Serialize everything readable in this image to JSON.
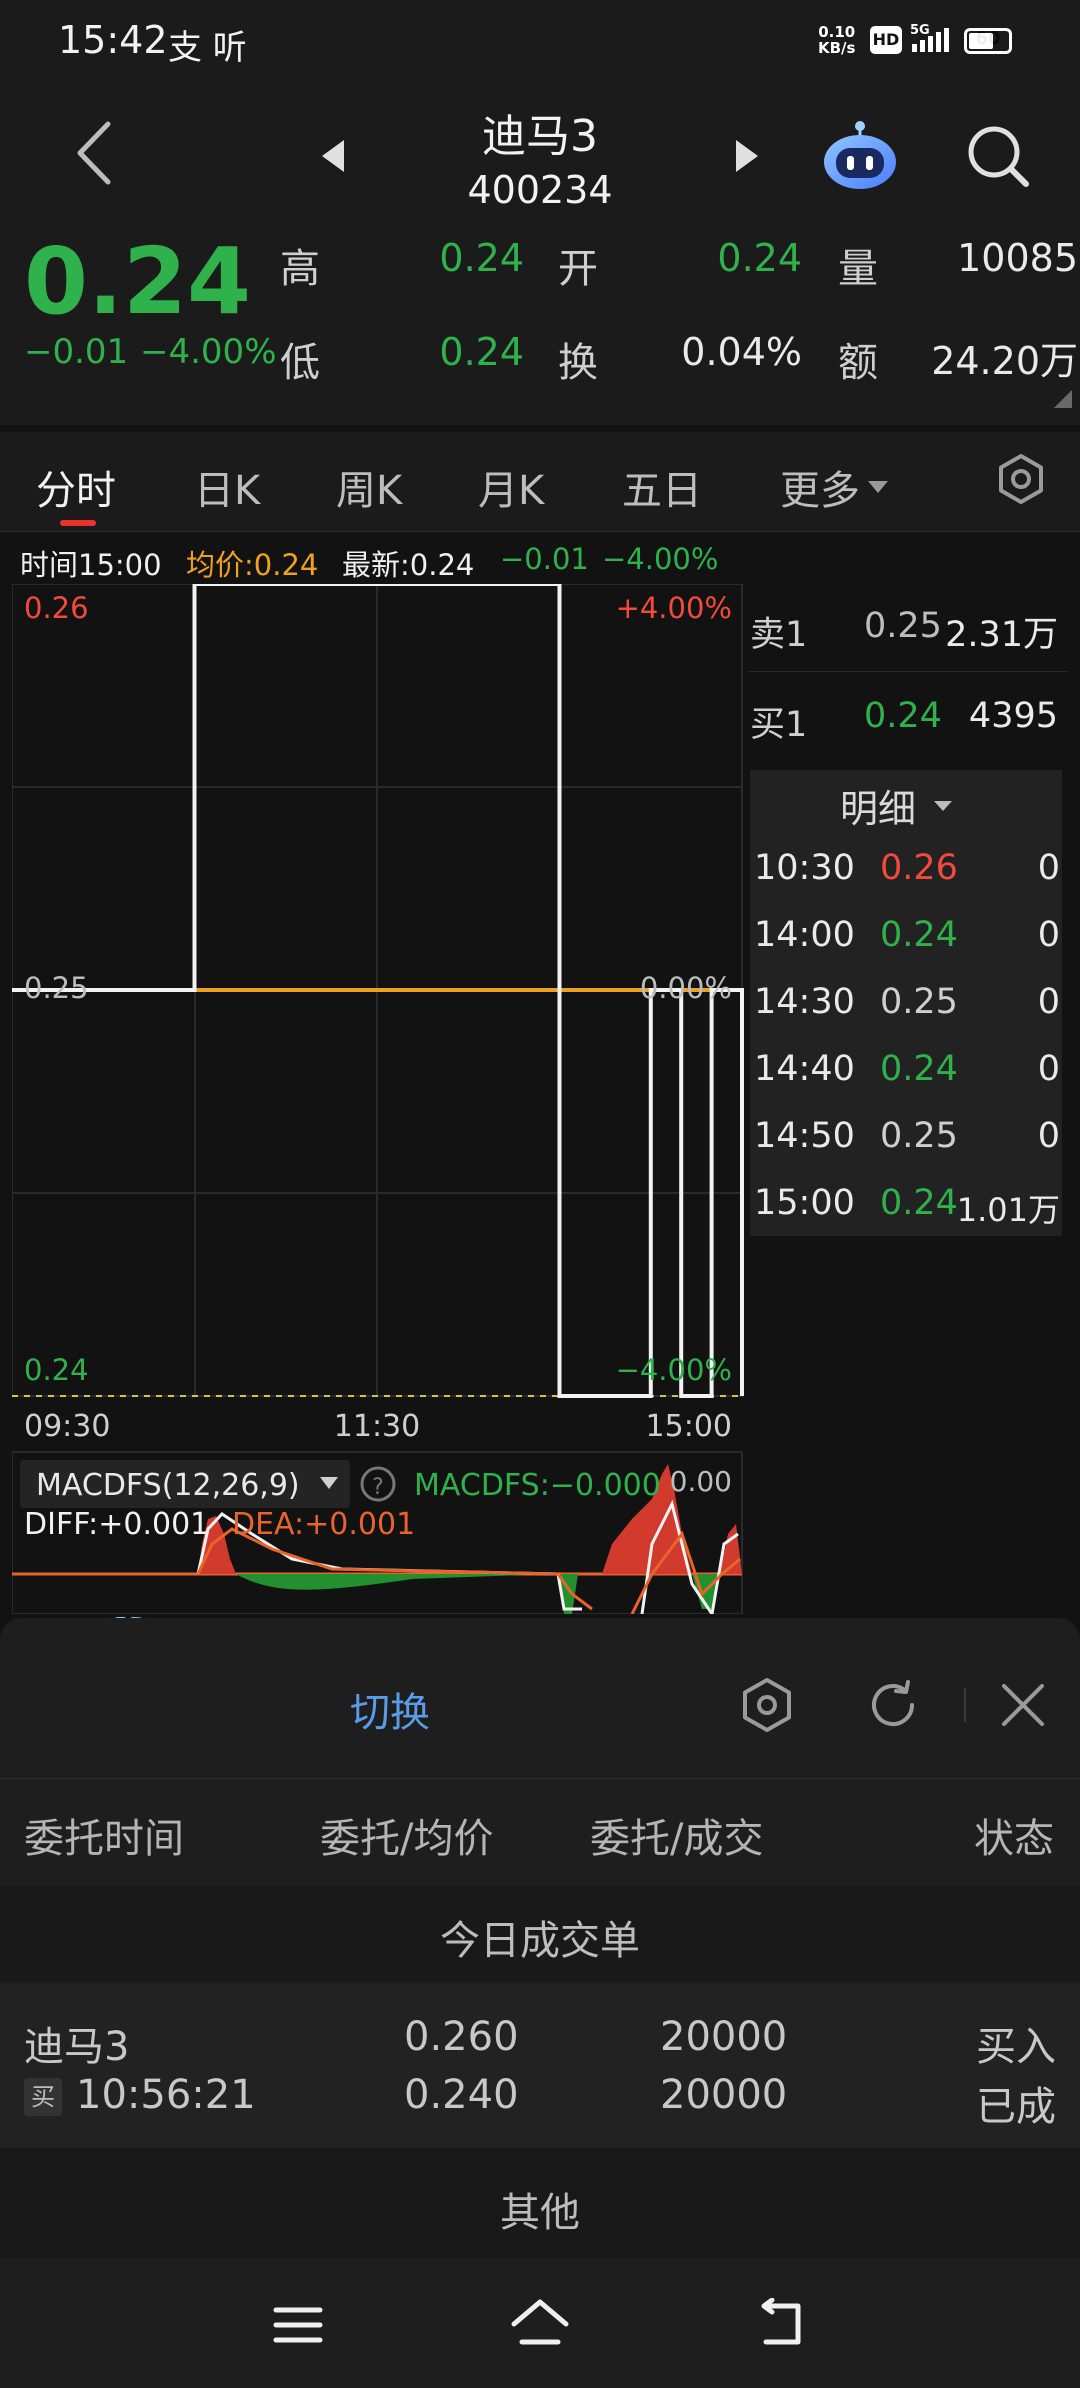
{
  "status_bar": {
    "time": "15:42",
    "app_icons": "⽀ 听",
    "net_speed_value": "0.10",
    "net_speed_unit": "KB/s",
    "hd": "HD",
    "network": "5G",
    "battery": "60"
  },
  "header": {
    "stock_name": "迪马3",
    "stock_code": "400234",
    "back_icon": "chevron-left-icon",
    "prev_icon": "triangle-left-icon",
    "next_icon": "triangle-right-icon",
    "robot_icon": "robot-assistant-icon",
    "search_icon": "search-icon"
  },
  "quote": {
    "price": "0.24",
    "change": "−0.01",
    "change_pct": "−4.00%",
    "high_label": "高",
    "high": "0.24",
    "low_label": "低",
    "low": "0.24",
    "open_label": "开",
    "open": "0.24",
    "turnover_label": "换",
    "turnover": "0.04%",
    "volume_label": "量",
    "volume": "10085",
    "amount_label": "额",
    "amount": "24.20万"
  },
  "tabs": [
    {
      "label": "分时",
      "active": true
    },
    {
      "label": "日K"
    },
    {
      "label": "周K"
    },
    {
      "label": "月K"
    },
    {
      "label": "五日"
    },
    {
      "label": "更多"
    }
  ],
  "info_line": {
    "time": "时间15:00",
    "avg": "均价:0.24",
    "latest": "最新:0.24",
    "chg": "−0.01",
    "pct": "−4.00%"
  },
  "chart_data": {
    "type": "line",
    "title": "",
    "y_left_ticks": [
      "0.26",
      "0.25",
      "0.24"
    ],
    "y_right_ticks": [
      "+4.00%",
      "0.00%",
      "−4.00%"
    ],
    "x_ticks": [
      "09:30",
      "11:30",
      "15:00"
    ],
    "ylim": [
      0.24,
      0.26
    ],
    "series": [
      {
        "values": [
          {
            "t": "09:30",
            "y": 0.25
          },
          {
            "t": "10:30",
            "y": 0.25
          },
          {
            "t": "10:30",
            "y": 0.26
          },
          {
            "t": "14:00",
            "y": 0.26
          },
          {
            "t": "14:00",
            "y": 0.24
          },
          {
            "t": "14:30",
            "y": 0.24
          },
          {
            "t": "14:30",
            "y": 0.25
          },
          {
            "t": "14:40",
            "y": 0.25
          },
          {
            "t": "14:40",
            "y": 0.24
          },
          {
            "t": "14:50",
            "y": 0.24
          },
          {
            "t": "14:50",
            "y": 0.25
          },
          {
            "t": "15:00",
            "y": 0.25
          },
          {
            "t": "15:00",
            "y": 0.24
          }
        ]
      },
      {
        "values": [
          {
            "t": "09:30",
            "y": 0.25
          },
          {
            "t": "15:00",
            "y": 0.25
          }
        ]
      }
    ],
    "reference_line": 0.25,
    "grid": true
  },
  "macd": {
    "selector": "MACDFS(12,26,9)",
    "value_label": "MACDFS:−0.000",
    "zero_label": "0.00",
    "diff": "DIFF:+0.001",
    "dea": "DEA:+0.001"
  },
  "order_book": {
    "sell1_label": "卖1",
    "sell1_price": "0.25",
    "sell1_vol": "2.31万",
    "buy1_label": "买1",
    "buy1_price": "0.24",
    "buy1_vol": "4395",
    "detail_label": "明细",
    "trades": [
      {
        "time": "10:30",
        "price": "0.26",
        "vol": "0",
        "color": "red"
      },
      {
        "time": "14:00",
        "price": "0.24",
        "vol": "0",
        "color": "green"
      },
      {
        "time": "14:30",
        "price": "0.25",
        "vol": "0",
        "color": "gray"
      },
      {
        "time": "14:40",
        "price": "0.24",
        "vol": "0",
        "color": "green"
      },
      {
        "time": "14:50",
        "price": "0.25",
        "vol": "0",
        "color": "gray"
      },
      {
        "time": "15:00",
        "price": "0.24",
        "vol": "1.01万",
        "color": "green"
      }
    ]
  },
  "sheet": {
    "switch_label": "切换",
    "columns": [
      "委托时间",
      "委托/均价",
      "委托/成交",
      "状态"
    ],
    "today_label": "今日成交单",
    "order": {
      "name": "迪马3",
      "side_badge": "买",
      "time": "10:56:21",
      "order_price": "0.260",
      "avg_price": "0.240",
      "order_qty": "20000",
      "filled_qty": "20000",
      "status_line1": "买入",
      "status_line2": "已成"
    },
    "other_label": "其他"
  },
  "colors": {
    "up": "#f24a3b",
    "down": "#2fb24c",
    "avg_line": "#f0a020",
    "background": "#121212"
  }
}
